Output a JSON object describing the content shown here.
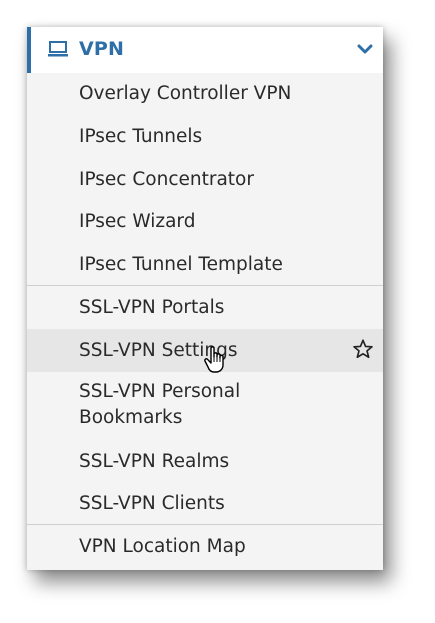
{
  "menu": {
    "header": {
      "label": "VPN",
      "icon": "laptop-icon",
      "expand_icon": "chevron-down-icon",
      "accent_color": "#2e6fa7"
    },
    "items": [
      {
        "label": "Overlay Controller VPN"
      },
      {
        "label": "IPsec Tunnels"
      },
      {
        "label": "IPsec Concentrator"
      },
      {
        "label": "IPsec Wizard"
      },
      {
        "label": "IPsec Tunnel Template"
      },
      {
        "label": "SSL-VPN Portals"
      },
      {
        "label": "SSL-VPN Settings",
        "hovered": true,
        "favorite_icon": "star-icon"
      },
      {
        "label_line1": "SSL-VPN Personal",
        "label_line2": "Bookmarks"
      },
      {
        "label": "SSL-VPN Realms"
      },
      {
        "label": "SSL-VPN Clients"
      },
      {
        "label": "VPN Location Map"
      }
    ]
  }
}
